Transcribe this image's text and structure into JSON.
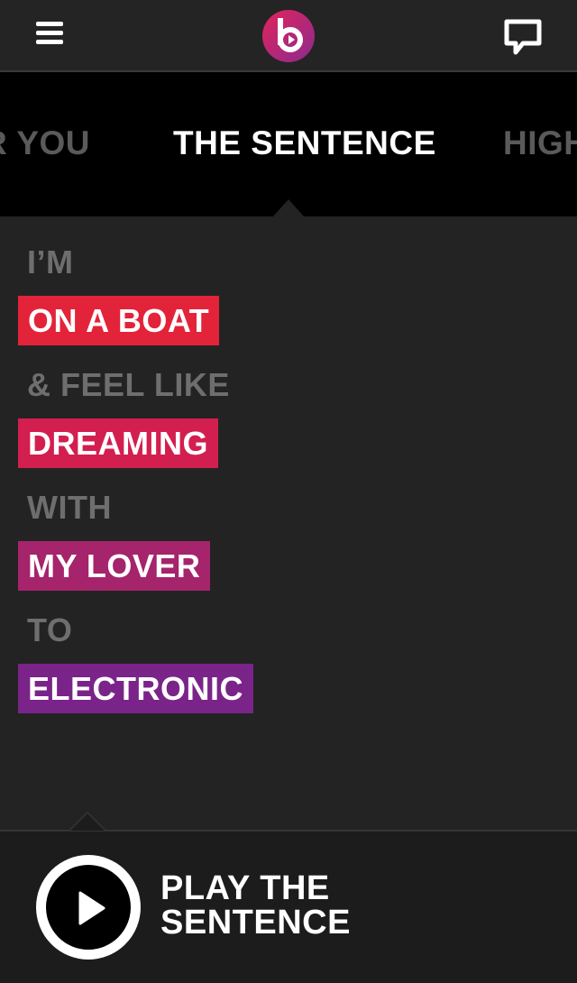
{
  "header": {
    "menu_icon": "hamburger-menu-icon",
    "logo_icon": "beats-logo-icon",
    "chat_icon": "chat-bubble-icon",
    "logo_colors": [
      "#e2245b",
      "#8c2a8e"
    ]
  },
  "tabs": [
    {
      "label": "R YOU",
      "active": false
    },
    {
      "label": "THE SENTENCE",
      "active": true
    },
    {
      "label": "HIGH",
      "active": false
    }
  ],
  "sentence": {
    "lines": [
      {
        "type": "static",
        "text": "I’M"
      },
      {
        "type": "choice",
        "text": "ON A BOAT",
        "color": "#e32339"
      },
      {
        "type": "static",
        "text": "& FEEL LIKE"
      },
      {
        "type": "choice",
        "text": "DREAMING",
        "color": "#d21f4f"
      },
      {
        "type": "static",
        "text": "WITH"
      },
      {
        "type": "choice",
        "text": "MY LOVER",
        "color": "#a5246c"
      },
      {
        "type": "static",
        "text": "TO"
      },
      {
        "type": "choice",
        "text": "ELECTRONIC",
        "color": "#7a2489"
      }
    ]
  },
  "footer": {
    "play_icon": "play-icon",
    "play_label_line1": "PLAY THE",
    "play_label_line2": "SENTENCE"
  }
}
